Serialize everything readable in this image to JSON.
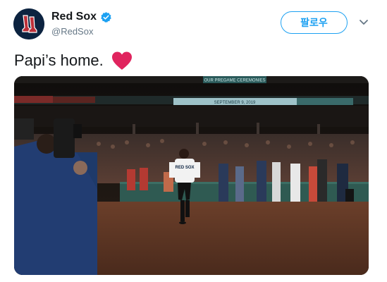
{
  "account": {
    "display_name": "Red Sox",
    "handle": "@RedSox",
    "verified": true,
    "avatar_icon": "red-sox-logo-icon"
  },
  "actions": {
    "follow_label": "팔로우",
    "more_icon": "chevron-down-icon"
  },
  "tweet": {
    "text": "Papi’s home.",
    "emoji": "heart-emoji"
  },
  "media": {
    "type": "video",
    "banner_top": "OUR PREGAME CEREMONIES",
    "banner_date": "SEPTEMBER 9, 2019",
    "jersey_text": "RED SOX"
  },
  "colors": {
    "brand_blue": "#1da1f2",
    "heart_red": "#e0245e",
    "text": "#14171a",
    "muted": "#657786",
    "sox_navy": "#0c2340",
    "sox_red": "#bd3039"
  }
}
